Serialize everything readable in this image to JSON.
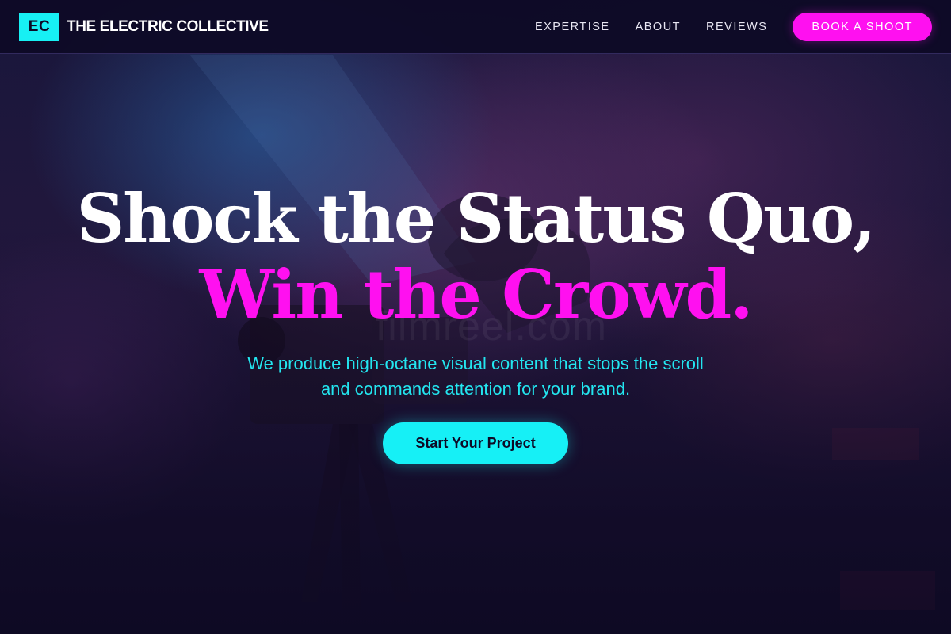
{
  "brand": {
    "badge": "EC",
    "name": "THE ELECTRIC COLLECTIVE"
  },
  "nav": {
    "links": [
      "EXPERTISE",
      "ABOUT",
      "REVIEWS"
    ],
    "cta_label": "BOOK A SHOOT"
  },
  "hero": {
    "headline_line1": "Shock the Status Quo,",
    "headline_line2": "Win the Crowd.",
    "subtitle_line1": "We produce high-octane visual content that stops the scroll",
    "subtitle_line2": "and commands attention for your brand.",
    "cta_label": "Start Your Project",
    "watermark": "filmreel.com",
    "background_icon": "camera-operator-photo"
  },
  "colors": {
    "accent_cyan": "#17f0f4",
    "accent_magenta": "#ff10f0",
    "navbar_bg": "#0e0a26",
    "hero_bg": "#140d2c"
  }
}
